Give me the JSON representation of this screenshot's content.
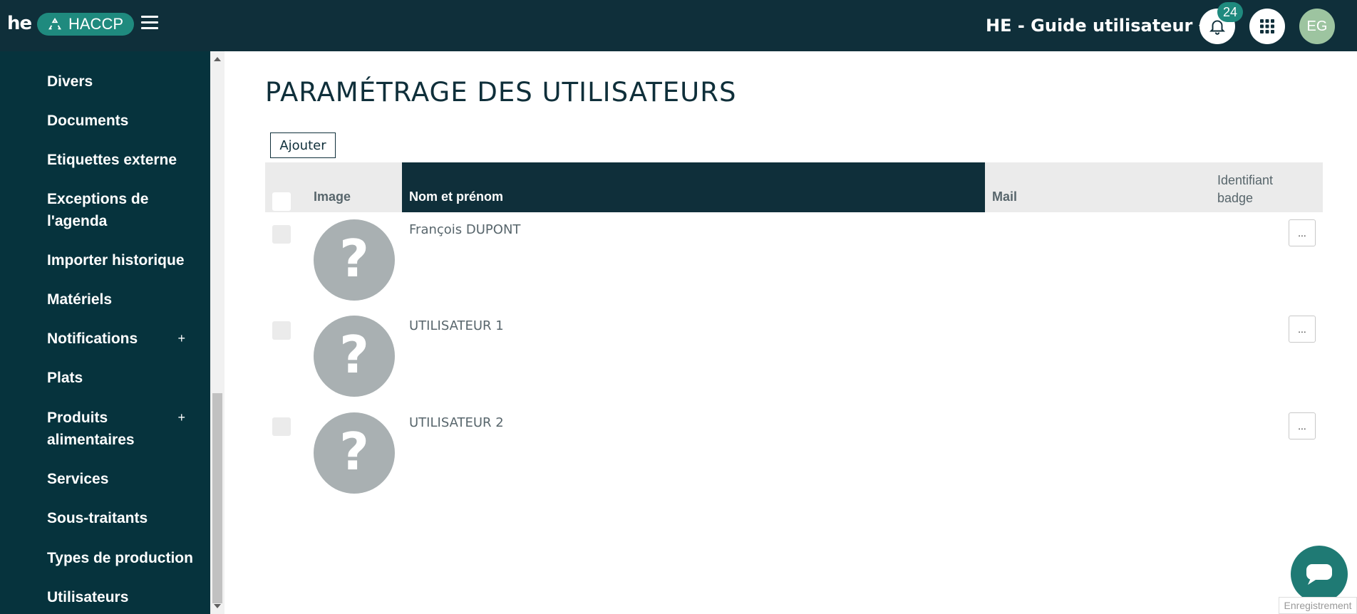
{
  "header": {
    "logo_text": "he",
    "app_name": "HACCP",
    "site_name": "HE - Guide utilisateur",
    "notification_count": "24",
    "user_initials": "EG"
  },
  "sidebar": {
    "items": [
      {
        "label": "Divers"
      },
      {
        "label": "Documents"
      },
      {
        "label": "Etiquettes externe"
      },
      {
        "label": "Exceptions de l'agenda"
      },
      {
        "label": "Importer historique"
      },
      {
        "label": "Matériels"
      },
      {
        "label": "Notifications",
        "expand": "+"
      },
      {
        "label": "Plats"
      },
      {
        "label": "Produits alimentaires",
        "expand": "+"
      },
      {
        "label": "Services"
      },
      {
        "label": "Sous-traitants"
      },
      {
        "label": "Types de production"
      },
      {
        "label": "Utilisateurs"
      }
    ]
  },
  "main": {
    "title": "PARAMÉTRAGE DES UTILISATEURS",
    "add_label": "Ajouter",
    "table": {
      "columns": {
        "image": "Image",
        "name": "Nom et prénom",
        "mail": "Mail",
        "badge": "Identifiant badge"
      },
      "rows": [
        {
          "name": "François DUPONT",
          "mail": "",
          "badge": "",
          "action": "..."
        },
        {
          "name": "UTILISATEUR 1",
          "mail": "",
          "badge": "",
          "action": "..."
        },
        {
          "name": "UTILISATEUR 2",
          "mail": "",
          "badge": "",
          "action": "..."
        }
      ]
    }
  },
  "footer": {
    "recording_label": "Enregistrement"
  },
  "colors": {
    "topbar": "#0f2f3a",
    "sidebar": "#06333d",
    "accent": "#1f8a7e",
    "header_active": "#0f2f3a"
  }
}
